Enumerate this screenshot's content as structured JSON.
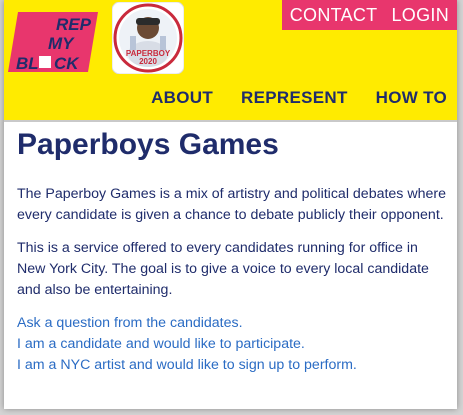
{
  "header": {
    "logo_lines": [
      "REP",
      "MY",
      "BL",
      "CK"
    ],
    "badge_text": [
      "PAPERBOY",
      "2020"
    ],
    "top_links": [
      "CONTACT",
      "LOGIN"
    ],
    "nav": [
      "ABOUT",
      "REPRESENT",
      "HOW TO"
    ]
  },
  "main": {
    "title": "Paperboys Games",
    "paragraphs": [
      "The Paperboy Games is a mix of artistry and political debates where every candidate is given a chance to debate publicly their opponent.",
      "This is a service offered to every candidates running for office in New York City. The goal is to give a voice to every local candidate and also be entertaining."
    ],
    "links": [
      "Ask a question from the candidates.",
      "I am a candidate and would like to participate.",
      "I am a NYC artist and would like to sign up to perform."
    ]
  },
  "colors": {
    "yellow": "#ffeb00",
    "pink": "#e8366d",
    "navy": "#1f2c6b",
    "link_blue": "#2b6cc4"
  }
}
